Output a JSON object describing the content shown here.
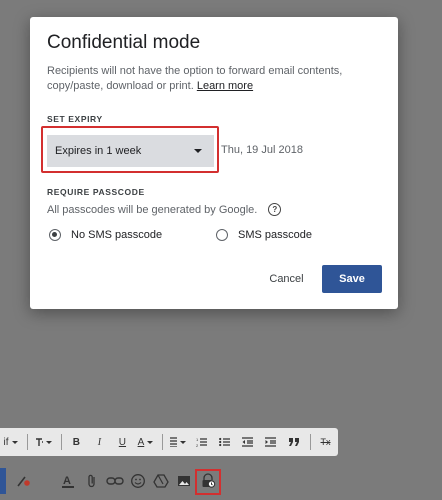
{
  "dialog": {
    "title": "Confidential mode",
    "description": "Recipients will not have the option to forward email contents, copy/paste, download or print.",
    "learn_more": "Learn more",
    "expiry": {
      "label": "SET EXPIRY",
      "selected": "Expires in 1 week",
      "date": "Thu, 19 Jul 2018"
    },
    "passcode": {
      "label": "REQUIRE PASSCODE",
      "note": "All passcodes will be generated by Google.",
      "help": "?",
      "options": [
        {
          "label": "No SMS passcode",
          "checked": true
        },
        {
          "label": "SMS passcode",
          "checked": false
        }
      ]
    },
    "buttons": {
      "cancel": "Cancel",
      "save": "Save"
    }
  },
  "format_toolbar": {
    "font_fragment": "if",
    "bold": "B",
    "italic": "I",
    "underline": "U",
    "text_color": "A",
    "clear": "Tx"
  },
  "compose_toolbar": {
    "icons": [
      "formatting-icon",
      "attach-icon",
      "link-icon",
      "emoji-icon",
      "drive-icon",
      "photo-icon",
      "confidential-mode-icon"
    ]
  },
  "colors": {
    "accent": "#2f5597",
    "highlight": "#d32f2f",
    "backdrop": "#7b7b7b"
  }
}
